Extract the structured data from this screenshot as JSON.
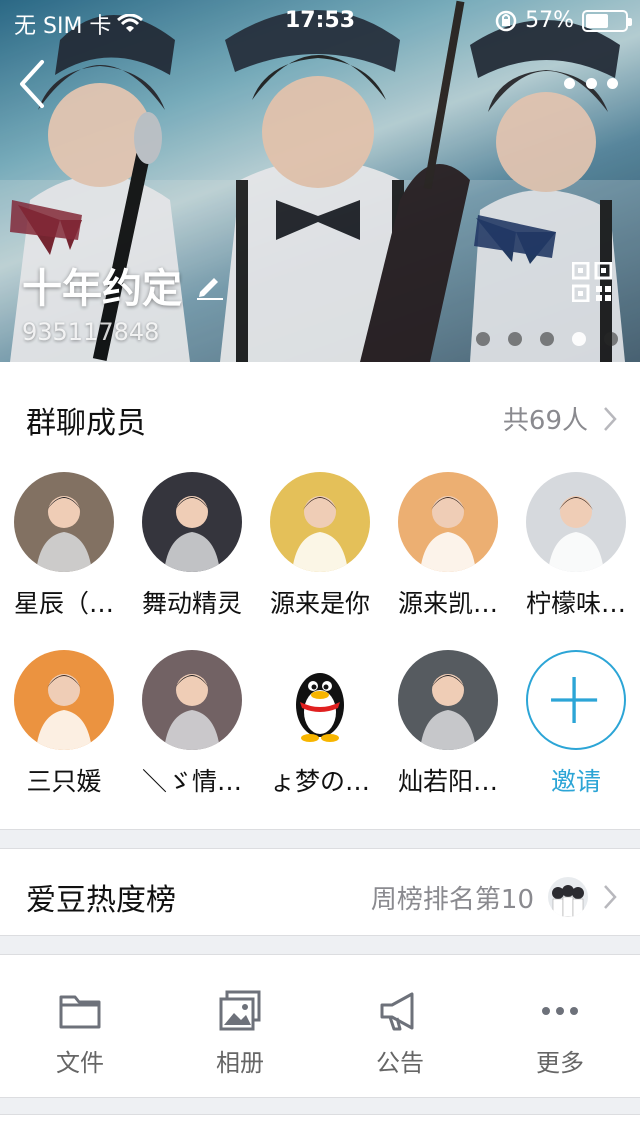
{
  "status_bar": {
    "carrier": "无 SIM 卡",
    "time": "17:53",
    "battery": "57%",
    "battery_level": 0.57
  },
  "header": {
    "group_name": "十年约定",
    "group_id": "935117848",
    "carousel_pages": 5,
    "carousel_active": 3,
    "icons": [
      "back-chevron",
      "more-dots",
      "edit-pencil",
      "qr-code"
    ]
  },
  "members": {
    "title": "群聊成员",
    "count_label": "共69人",
    "items": [
      {
        "name": "星辰（…",
        "avatar_color": "#7c6a5a"
      },
      {
        "name": "舞动精灵",
        "avatar_color": "#2b2b33"
      },
      {
        "name": "源来是你",
        "avatar_color": "#e0b53c"
      },
      {
        "name": "源来凯…",
        "avatar_color": "#e9a15a"
      },
      {
        "name": "柠檬味…",
        "avatar_color": "#cfd3d8"
      },
      {
        "name": "三只媛",
        "avatar_color": "#e8801f"
      },
      {
        "name": "＼ゞ情…",
        "avatar_color": "#6b5a5c"
      },
      {
        "name": "ょ梦の…",
        "avatar_color": "#ffffff"
      },
      {
        "name": "灿若阳…",
        "avatar_color": "#4d5358"
      }
    ],
    "invite_label": "邀请"
  },
  "ranking": {
    "title": "爱豆热度榜",
    "rank_label": "周榜排名第10"
  },
  "tools": [
    {
      "label": "文件",
      "icon": "folder-icon"
    },
    {
      "label": "相册",
      "icon": "album-icon"
    },
    {
      "label": "公告",
      "icon": "megaphone-icon"
    },
    {
      "label": "更多",
      "icon": "more-icon"
    }
  ],
  "colors": {
    "accent": "#2ca5d6",
    "secondary_text": "#8a8a8f",
    "background": "#eef0f3"
  }
}
